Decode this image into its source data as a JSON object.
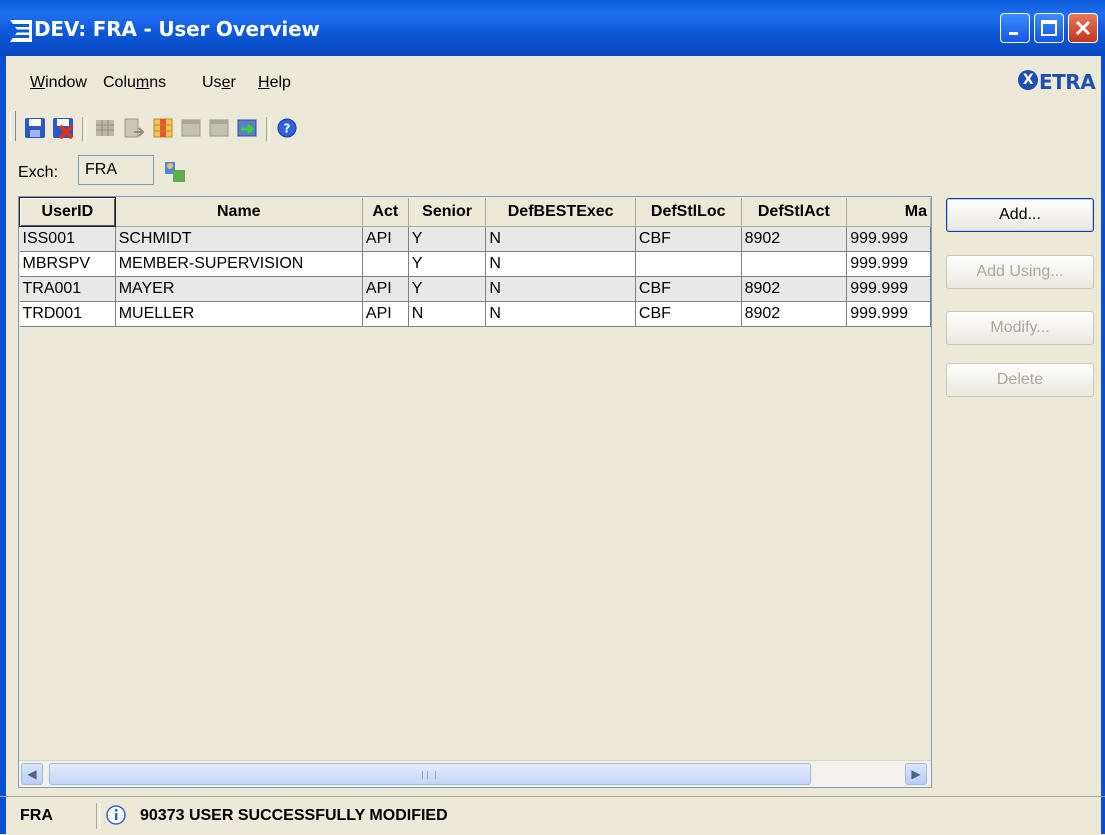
{
  "window": {
    "title": "DEV: FRA - User Overview"
  },
  "menu": {
    "items": [
      {
        "label": "Window",
        "mnemonic": "W"
      },
      {
        "label": "Columns",
        "mnemonic": "m"
      },
      {
        "label": "User",
        "mnemonic": "e"
      },
      {
        "label": "Help",
        "mnemonic": "H"
      }
    ],
    "brand": "ETRA"
  },
  "toolbar": {
    "icons": [
      "save-icon",
      "save-close-icon",
      "grid-icon",
      "document-arrow-icon",
      "columns-icon",
      "table-icon",
      "window-icon",
      "refresh-icon",
      "help-icon"
    ]
  },
  "exchange": {
    "label": "Exch:",
    "value": "FRA"
  },
  "table": {
    "columns": [
      "UserID",
      "Name",
      "Act",
      "Senior",
      "DefBESTExec",
      "DefStlLoc",
      "DefStlAct",
      "Ma"
    ],
    "rows": [
      [
        "ISS001",
        "SCHMIDT",
        "API",
        "Y",
        "N",
        "CBF",
        "8902",
        "999.999"
      ],
      [
        "MBRSPV",
        "MEMBER-SUPERVISION",
        "",
        "Y",
        "N",
        "",
        "",
        "999.999"
      ],
      [
        "TRA001",
        "MAYER",
        "API",
        "Y",
        "N",
        "CBF",
        "8902",
        "999.999"
      ],
      [
        "TRD001",
        "MUELLER",
        "API",
        "N",
        "N",
        "CBF",
        "8902",
        "999.999"
      ]
    ]
  },
  "actions": {
    "add": "Add...",
    "add_using": "Add Using...",
    "modify": "Modify...",
    "delete": "Delete"
  },
  "status": {
    "exchange": "FRA",
    "message": "90373 USER SUCCESSFULLY MODIFIED"
  },
  "colors": {
    "titlebar": "#0a5bd8",
    "window_bg": "#ece9d8",
    "row_alt": "#e8e8e8",
    "brand": "#1f4fb0"
  }
}
